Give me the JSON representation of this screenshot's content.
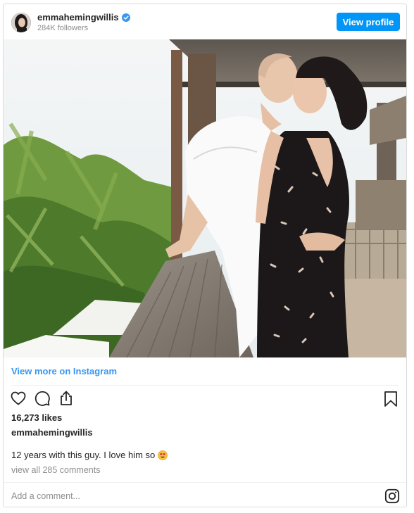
{
  "post": {
    "username": "emmahemingwillis",
    "followers": "284K followers",
    "view_profile_label": "View profile",
    "view_more_label": "View more on Instagram",
    "likes": "16,273 likes",
    "caption_user": "emmahemingwillis",
    "caption_text": "12 years with this guy. I love him so",
    "caption_emoji": "smiling-face-with-heart-eyes",
    "view_comments_label": "view all 285 comments",
    "add_comment_placeholder": "Add a comment..."
  },
  "icons": {
    "verified": "verified-badge-icon",
    "like": "heart-icon",
    "comment": "comment-icon",
    "share": "share-icon",
    "save": "bookmark-icon",
    "brand": "instagram-icon"
  },
  "colors": {
    "button_blue": "#0095f6",
    "link_blue": "#3897f0",
    "text_primary": "#262626",
    "text_secondary": "#8e8e8e",
    "border": "#dbdbdb"
  }
}
